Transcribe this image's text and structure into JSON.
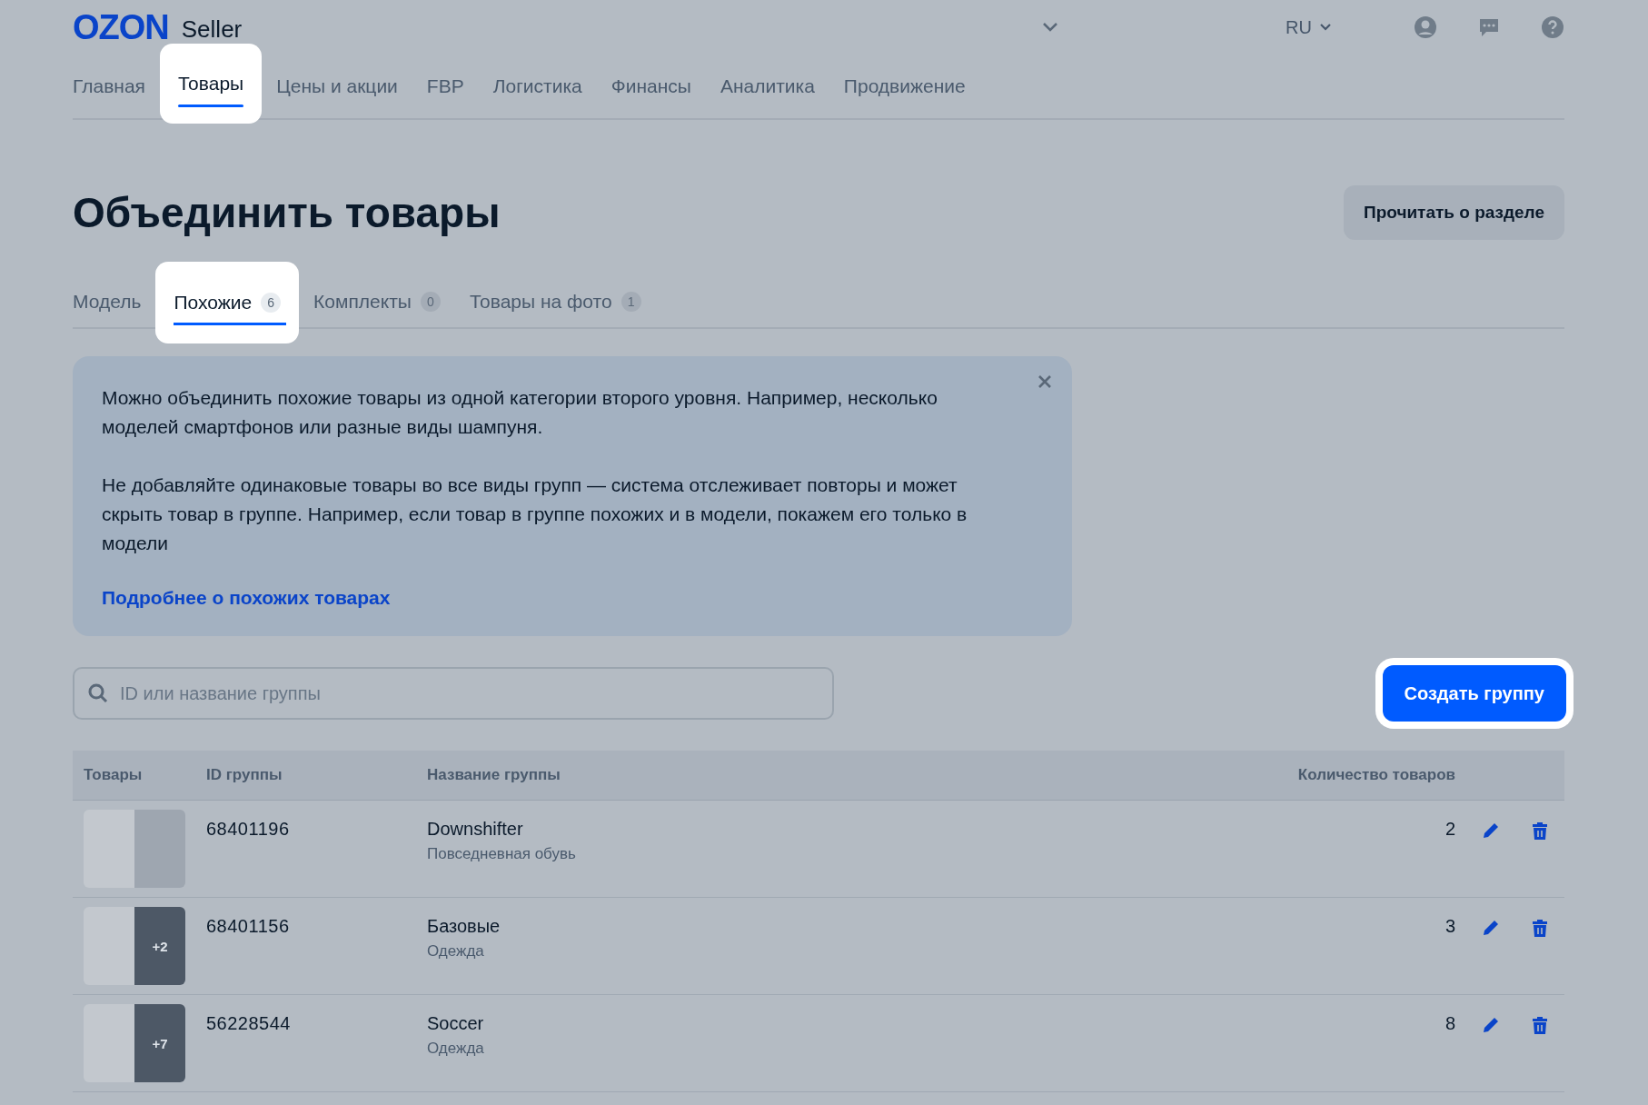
{
  "header": {
    "logo": "OZON",
    "logo_suffix": "Seller",
    "language": "RU"
  },
  "nav": [
    {
      "label": "Главная",
      "selected": false
    },
    {
      "label": "Товары",
      "selected": true
    },
    {
      "label": "Цены и акции",
      "selected": false
    },
    {
      "label": "FBP",
      "selected": false
    },
    {
      "label": "Логистика",
      "selected": false
    },
    {
      "label": "Финансы",
      "selected": false
    },
    {
      "label": "Аналитика",
      "selected": false
    },
    {
      "label": "Продвижение",
      "selected": false
    }
  ],
  "page": {
    "title": "Объединить товары",
    "read_button": "Прочитать о разделе"
  },
  "tabs": [
    {
      "label": "Модель",
      "selected": false
    },
    {
      "label": "Похожие",
      "count": "6",
      "selected": true
    },
    {
      "label": "Комплекты",
      "count": "0",
      "selected": false
    },
    {
      "label": "Товары на фото",
      "count": "1",
      "selected": false
    }
  ],
  "info": {
    "paragraphs": [
      "Можно объединить похожие товары из одной категории второго уровня. Например, несколько моделей смартфонов или разные виды шампуня.",
      "Не добавляйте одинаковые товары во все виды групп — система отслеживает повторы и может скрыть товар в группе. Например, если товар в группе похожих и в модели, покажем его только в модели"
    ],
    "link": "Подробнее о похожих товарах"
  },
  "search": {
    "placeholder": "ID или название группы"
  },
  "create_button": {
    "label": "Создать группу",
    "highlighted": true
  },
  "table": {
    "columns": [
      "Товары",
      "ID группы",
      "Название группы",
      "Количество товаров"
    ],
    "rows": [
      {
        "id": "68401196",
        "name": "Downshifter",
        "category": "Повседневная обувь",
        "count": "2"
      },
      {
        "id": "68401156",
        "name": "Базовые",
        "category": "Одежда",
        "count": "3",
        "more": "+2"
      },
      {
        "id": "56228544",
        "name": "Soccer",
        "category": "Одежда",
        "count": "8",
        "more": "+7"
      }
    ]
  }
}
